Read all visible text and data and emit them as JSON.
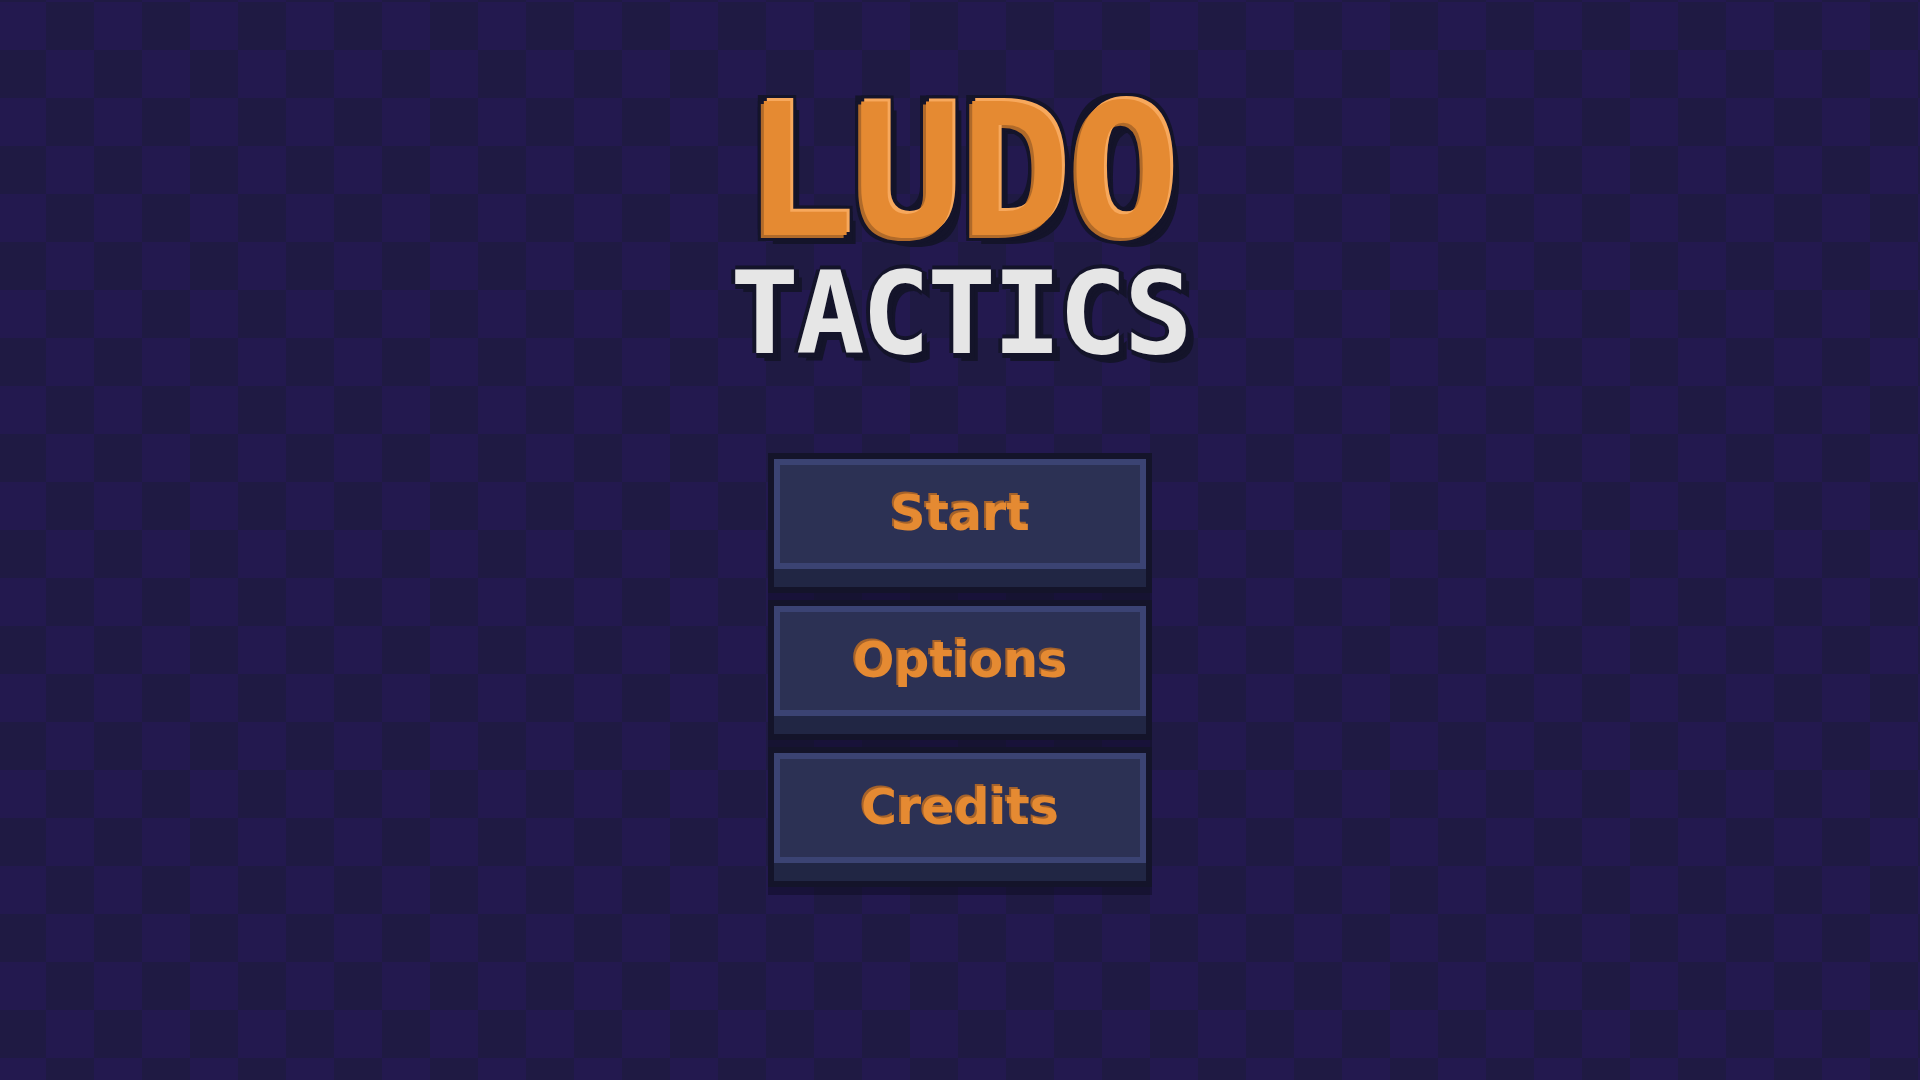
{
  "title": {
    "main": "LUDO",
    "sub": "TACTICS"
  },
  "menu": [
    {
      "label": "Start"
    },
    {
      "label": "Options"
    },
    {
      "label": "Credits"
    }
  ]
}
